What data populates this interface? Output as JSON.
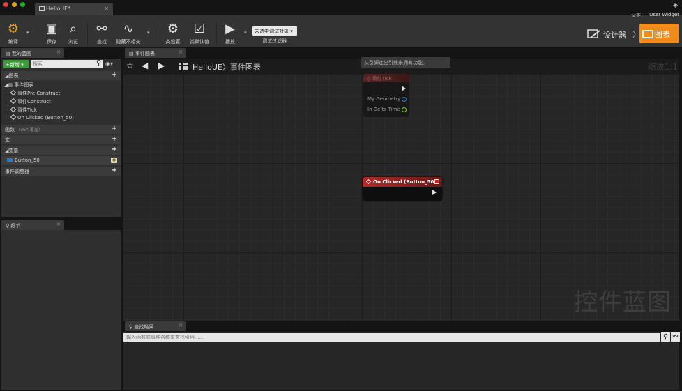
{
  "window": {
    "tab_label": "HelloUE*",
    "parent_label": "父类：",
    "parent_value": "User Widget"
  },
  "toolbar": {
    "compile": "编译",
    "save": "保存",
    "browse": "浏览",
    "find": "查找",
    "hide_unrelated": "隐藏不相关",
    "class_settings": "类设置",
    "class_defaults": "类默认值",
    "play": "播放",
    "debug_object": "未选中调试对象",
    "debug_filter": "调试过滤器",
    "designer": "设计器",
    "graph": "图表"
  },
  "my_blueprint": {
    "tab": "我的蓝图",
    "add_label": "+新增",
    "search_placeholder": "搜索",
    "sections": {
      "graphs": "图表",
      "functions": "函数",
      "functions_sub": "（36可覆盖）",
      "macros": "宏",
      "variables": "变量",
      "dispatchers": "事件调度器"
    },
    "event_graph": "事件图表",
    "events": [
      "事件Pre Construct",
      "事件Construct",
      "事件Tick",
      "On Clicked (Button_50)"
    ],
    "variable": "Button_50"
  },
  "details": {
    "tab": "细节"
  },
  "graph": {
    "tab": "事件图表",
    "breadcrumb_root": "HelloUE",
    "breadcrumb_sep": "〉",
    "breadcrumb_current": "事件图表",
    "zoom": "缩放1:1",
    "watermark": "控件蓝图",
    "tooltip": "从引脚连出引线来拥有功能。",
    "tick_node": {
      "title": "事件Tick",
      "pins": [
        "My Geometry",
        "In Delta Time"
      ]
    },
    "click_node": {
      "title": "On Clicked (Button_50)"
    }
  },
  "find_results": {
    "tab": "查找结果",
    "placeholder": "输入函数或事件名称来查找引用......"
  },
  "colors": {
    "accent_orange": "#f08c1c",
    "add_green": "#3d9a3a",
    "event_red": "#b32a2a",
    "variable_blue": "#1e7bd0"
  }
}
